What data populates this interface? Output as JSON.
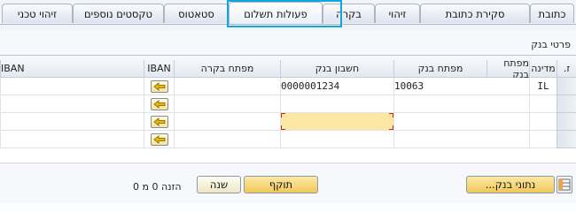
{
  "tabs": [
    {
      "label": "כתובת"
    },
    {
      "label": "סקירת כתובת"
    },
    {
      "label": "זיהוי"
    },
    {
      "label": "בקרה"
    },
    {
      "label": "פעולות תשלום"
    },
    {
      "label": "סטאטוס"
    },
    {
      "label": "טקסטים נוספים"
    },
    {
      "label": "זיהוי טכני"
    }
  ],
  "active_tab": "פעולות תשלום",
  "group_title": "פרטי בנק",
  "table": {
    "headers": {
      "rownum": "ז.",
      "country": "מדינה",
      "bank_key": "מפתח בנק",
      "account": "חשבון בנק",
      "control_key": "מפתח בקרה",
      "iban_btn": "IBAN",
      "iban": "IBAN"
    },
    "rows": [
      {
        "country": "IL",
        "bank_key": "10063",
        "account": "0000001234",
        "control_key": ""
      },
      {
        "country": "",
        "bank_key": "",
        "account": "",
        "control_key": ""
      },
      {
        "country": "",
        "bank_key": "",
        "account": "",
        "control_key": ""
      },
      {
        "country": "",
        "bank_key": "",
        "account": "",
        "control_key": ""
      }
    ]
  },
  "scrollbar": {
    "thumb": "..."
  },
  "buttons": {
    "bank_data": "נתוני בנק...",
    "valid": "תוקף",
    "change": "שנה"
  },
  "status": {
    "label": "הזנה",
    "value": "0 מ 0"
  }
}
